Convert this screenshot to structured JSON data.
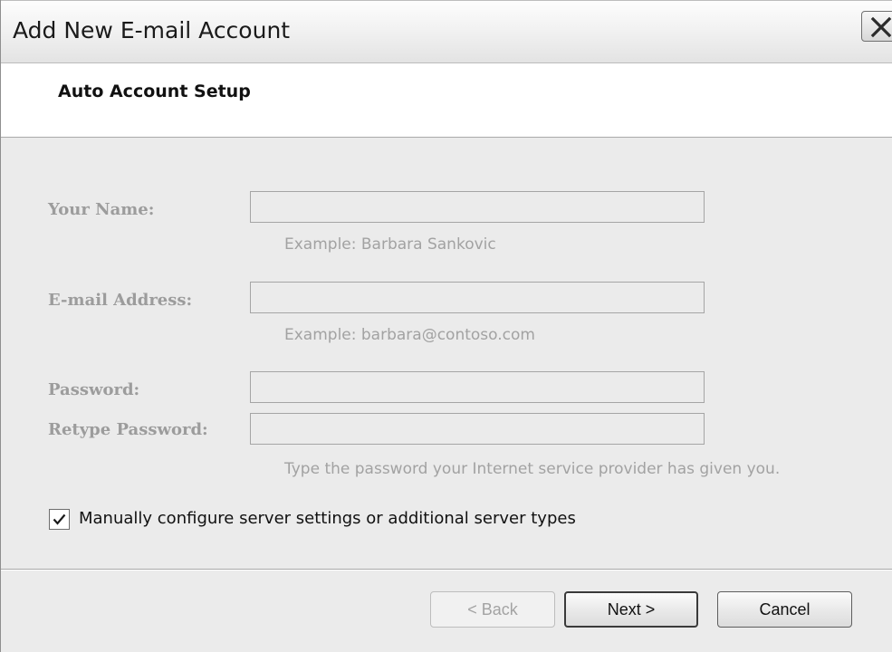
{
  "window": {
    "title": "Add New E-mail Account"
  },
  "header": {
    "title": "Auto Account Setup"
  },
  "form": {
    "name_label": "Your Name:",
    "name_value": "",
    "name_hint": "Example: Barbara Sankovic",
    "email_label": "E-mail Address:",
    "email_value": "",
    "email_hint": "Example: barbara@contoso.com",
    "password_label": "Password:",
    "password_value": "",
    "retype_label": "Retype Password:",
    "retype_value": "",
    "password_hint": "Type the password your Internet service provider has given you.",
    "manual_config_label": "Manually configure server settings or additional server types",
    "manual_config_checked": true
  },
  "buttons": {
    "back": "< Back",
    "next": "Next >",
    "cancel": "Cancel"
  },
  "icons": {
    "close": "close-icon",
    "check": "checkmark-icon"
  }
}
